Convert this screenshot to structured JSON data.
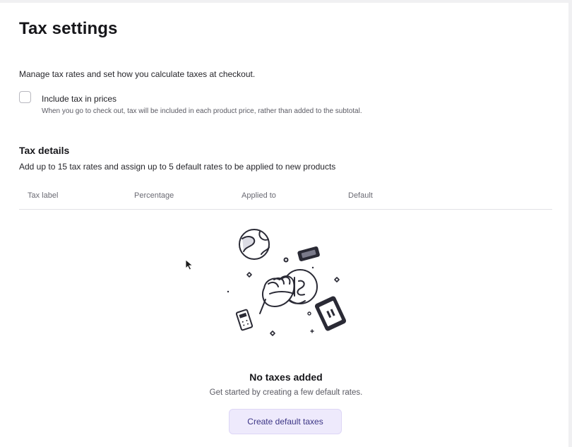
{
  "header": {
    "title": "Tax settings"
  },
  "intro": "Manage tax rates and set how you calculate taxes at checkout.",
  "include_tax": {
    "label": "Include tax in prices",
    "help": "When you go to check out, tax will be included in each product price, rather than added to the subtotal.",
    "checked": false
  },
  "tax_details": {
    "title": "Tax details",
    "description": "Add up to 15 tax rates and assign up to 5 default rates to be applied to new products",
    "columns": [
      "Tax label",
      "Percentage",
      "Applied to",
      "Default"
    ]
  },
  "empty_state": {
    "title": "No taxes added",
    "description": "Get started by creating a few default rates.",
    "button_label": "Create default taxes"
  },
  "colors": {
    "accent_button_bg": "#eeeafc",
    "accent_button_text": "#3c3585"
  },
  "icons": [
    "empty-state-illustration",
    "mouse-cursor-icon"
  ]
}
